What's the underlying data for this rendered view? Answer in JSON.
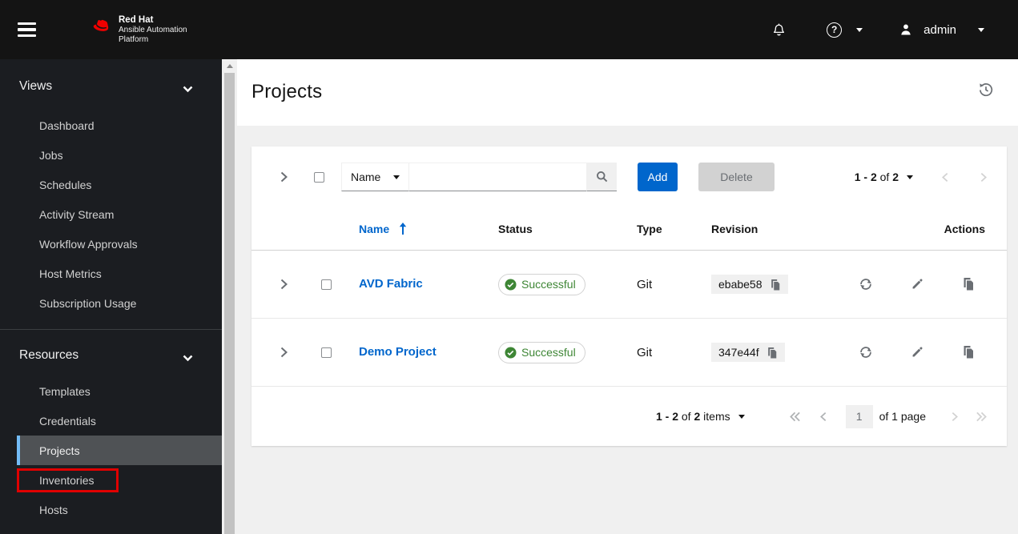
{
  "masthead": {
    "brand_line1": "Red Hat",
    "brand_line2": "Ansible Automation",
    "brand_line3": "Platform",
    "username": "admin"
  },
  "sidebar": {
    "sections": [
      {
        "label": "Views",
        "items": [
          {
            "label": "Dashboard"
          },
          {
            "label": "Jobs"
          },
          {
            "label": "Schedules"
          },
          {
            "label": "Activity Stream"
          },
          {
            "label": "Workflow Approvals"
          },
          {
            "label": "Host Metrics"
          },
          {
            "label": "Subscription Usage"
          }
        ]
      },
      {
        "label": "Resources",
        "items": [
          {
            "label": "Templates"
          },
          {
            "label": "Credentials"
          },
          {
            "label": "Projects",
            "state": "active"
          },
          {
            "label": "Inventories",
            "state": "highlighted-with-red-annotation-box"
          },
          {
            "label": "Hosts"
          }
        ]
      }
    ]
  },
  "page": {
    "title": "Projects"
  },
  "toolbar": {
    "filter": {
      "selected": "Name"
    },
    "search": {
      "value": "",
      "placeholder": ""
    },
    "buttons": {
      "add": "Add",
      "delete": "Delete"
    },
    "pagination": {
      "range": "1 - 2",
      "of_word": "of",
      "total": "2"
    }
  },
  "table": {
    "columns": {
      "name": "Name",
      "status": "Status",
      "type": "Type",
      "revision": "Revision",
      "actions": "Actions"
    },
    "sorted_by": "Name ascending",
    "rows": [
      {
        "name": "AVD Fabric",
        "status": "Successful",
        "type": "Git",
        "revision": "ebabe58"
      },
      {
        "name": "Demo Project",
        "status": "Successful",
        "type": "Git",
        "revision": "347e44f"
      }
    ]
  },
  "footer_pagination": {
    "range": "1 - 2",
    "of_word": "of",
    "total": "2",
    "items_word": "items",
    "current_page": "1",
    "page_of": "of 1 page"
  },
  "colors": {
    "accent_blue": "#0066cc",
    "link_blue": "#0066cc",
    "success_green": "#3e8635",
    "nav_active_border": "#73bcf7",
    "annotation_red": "#e00000",
    "masthead_bg": "#141414",
    "sidebar_bg": "#1b1d21",
    "body_bg": "#f0f0f0"
  }
}
